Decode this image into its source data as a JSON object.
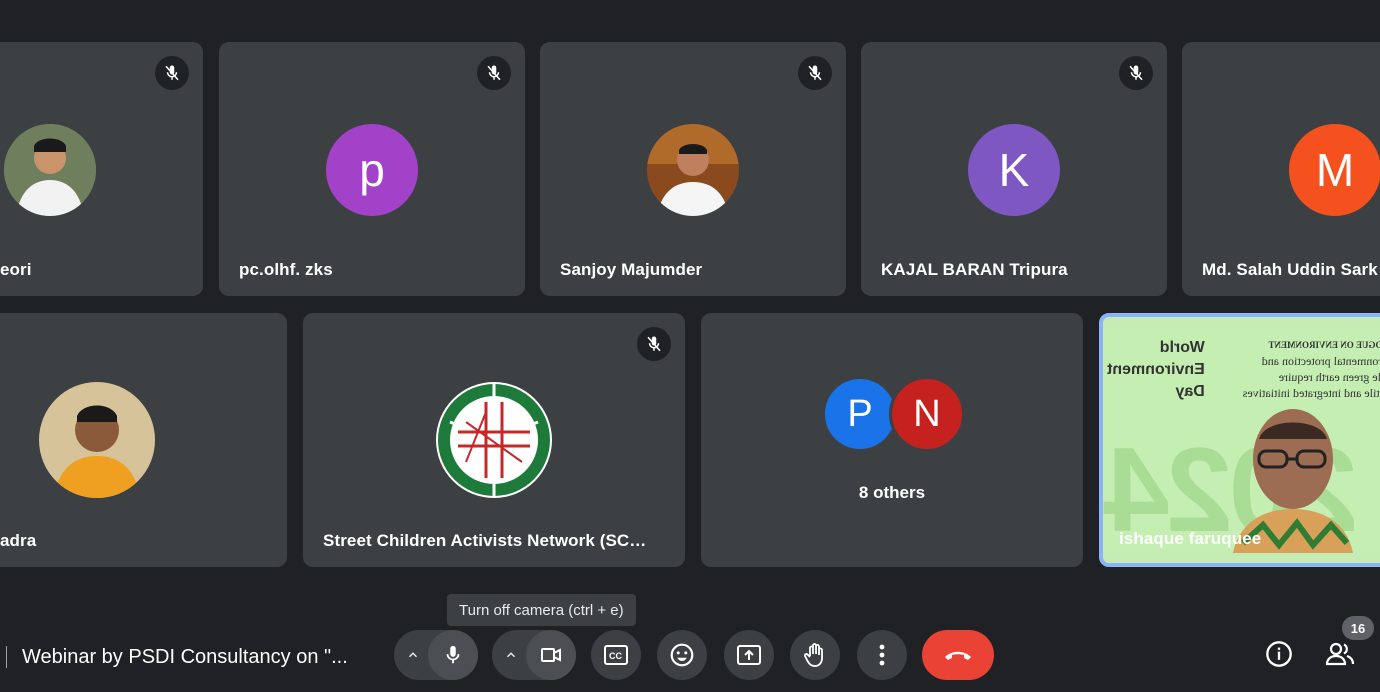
{
  "participants_row1": [
    {
      "name": "eori",
      "avatar_type": "photo"
    },
    {
      "name": "pc.olhf. zks",
      "avatar_letter": "p",
      "avatar_color": "#a142c8"
    },
    {
      "name": "Sanjoy Majumder",
      "avatar_type": "photo"
    },
    {
      "name": "KAJAL BARAN Tripura",
      "avatar_letter": "K",
      "avatar_color": "#7e57c2"
    },
    {
      "name": "Md. Salah Uddin Sark",
      "avatar_letter": "M",
      "avatar_color": "#f4511e"
    }
  ],
  "participants_row2": [
    {
      "name": "adra",
      "avatar_type": "photo"
    },
    {
      "name": "Street Children Activists Network (SC…",
      "avatar_type": "logo"
    },
    {
      "others_label": "8 others",
      "letters": [
        "P",
        "N"
      ],
      "colors": [
        "#1a73e8",
        "#c5221f"
      ]
    },
    {
      "name": "ishaque faruquee",
      "avatar_type": "video",
      "slide_lines": [
        "DIALOGUE ON ENVIRONMENT",
        "Environmental protection and",
        "livable green earth require",
        "versatile and integrated initiatives"
      ],
      "slide_title": [
        "World",
        "Environment",
        "Day"
      ],
      "slide_year": "2024"
    }
  ],
  "toolbar": {
    "meeting_title": "Webinar by PSDI Consultancy on \"...",
    "tooltip": "Turn off camera (ctrl + e)",
    "participant_count": "16"
  },
  "icons": {
    "mic": "mic-icon",
    "camera": "videocam-icon",
    "captions": "closed-caption-icon",
    "emoji": "emoji-icon",
    "present": "present-screen-icon",
    "raise_hand": "raise-hand-icon",
    "more": "more-vert-icon",
    "end_call": "call-end-icon",
    "info": "info-icon",
    "people": "people-icon",
    "muted": "mic-off-icon"
  },
  "colors": {
    "background": "#202124",
    "tile": "#3c4043",
    "end_call": "#ea4335",
    "active_speaker_border": "#8ab4f8"
  }
}
